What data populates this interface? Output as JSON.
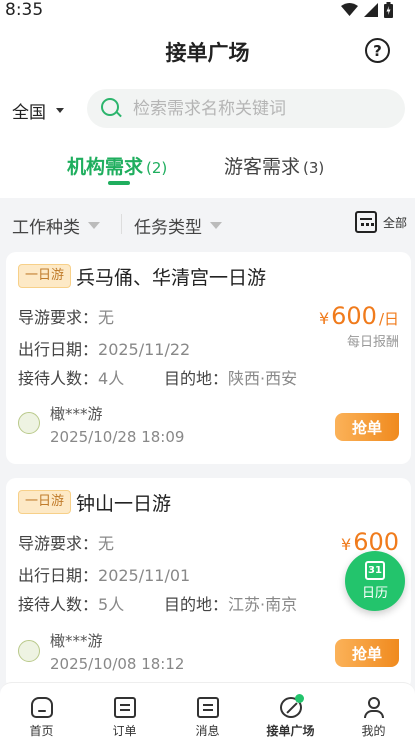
{
  "status_bar": {
    "time": "8:35"
  },
  "header": {
    "title": "接单广场",
    "help_icon": "help-circle-icon"
  },
  "search": {
    "region": "全国",
    "placeholder": "检索需求名称关键词"
  },
  "tabs": [
    {
      "label": "机构需求",
      "count": "(2)",
      "active": true
    },
    {
      "label": "游客需求",
      "count": "(3)",
      "active": false
    }
  ],
  "filters": {
    "work_type": "工作种类",
    "task_type": "任务类型",
    "all": "全部"
  },
  "cards": [
    {
      "tag": "一日游",
      "title": "兵马俑、华清宫一日游",
      "guide_label": "导游要求：",
      "guide_value": "无",
      "date_label": "出行日期：",
      "date_value": "2025/11/22",
      "people_label": "接待人数：",
      "people_value": "4人",
      "dest_label": "目的地：",
      "dest_value": "陕西·西安",
      "price_symbol": "¥",
      "price": "600",
      "price_unit": "/日",
      "price_note": "每日报酬",
      "user": "橄***游",
      "time": "2025/10/28 18:09",
      "button": "抢单"
    },
    {
      "tag": "一日游",
      "title": "钟山一日游",
      "guide_label": "导游要求：",
      "guide_value": "无",
      "date_label": "出行日期：",
      "date_value": "2025/11/01",
      "people_label": "接待人数：",
      "people_value": "5人",
      "dest_label": "目的地：",
      "dest_value": "江苏·南京",
      "price_symbol": "¥",
      "price": "600",
      "user": "橄***游",
      "time": "2025/10/08 18:12",
      "button": "抢单"
    }
  ],
  "fab": {
    "day": "31",
    "label": "日历"
  },
  "bottom_nav": [
    {
      "label": "首页",
      "icon": "home-icon"
    },
    {
      "label": "订单",
      "icon": "order-icon"
    },
    {
      "label": "消息",
      "icon": "message-icon"
    },
    {
      "label": "接单广场",
      "icon": "grab-order-icon",
      "active": true
    },
    {
      "label": "我的",
      "icon": "profile-icon"
    }
  ],
  "colors": {
    "accent": "#1fae5e",
    "price": "#f07b1c",
    "tag_bg": "#fde9c6"
  }
}
